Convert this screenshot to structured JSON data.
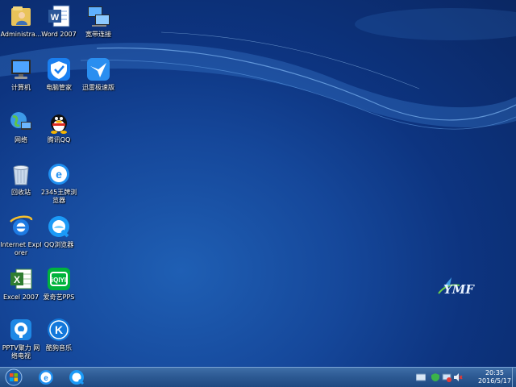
{
  "desktop": {
    "icons": [
      {
        "label": "Administra...",
        "icon": "user-folder-icon"
      },
      {
        "label": "Word 2007",
        "icon": "word-icon"
      },
      {
        "label": "宽带连接",
        "icon": "broadband-icon"
      },
      {
        "label": "计算机",
        "icon": "computer-icon"
      },
      {
        "label": "电脑管家",
        "icon": "pc-manager-icon"
      },
      {
        "label": "迅雷极速版",
        "icon": "thunder-icon"
      },
      {
        "label": "网络",
        "icon": "network-icon"
      },
      {
        "label": "腾讯QQ",
        "icon": "qq-icon"
      },
      {
        "label": "回收站",
        "icon": "recycle-bin-icon"
      },
      {
        "label": "2345王牌浏览器",
        "icon": "browser-2345-icon"
      },
      {
        "label": "Internet Explorer",
        "icon": "ie-icon"
      },
      {
        "label": "QQ浏览器",
        "icon": "qq-browser-icon"
      },
      {
        "label": "Excel 2007",
        "icon": "excel-icon"
      },
      {
        "label": "爱奇艺PPS",
        "icon": "iqiyi-icon"
      },
      {
        "label": "PPTV聚力 网络电视",
        "icon": "pptv-icon"
      },
      {
        "label": "酷狗音乐",
        "icon": "kugou-icon"
      }
    ]
  },
  "taskbar": {
    "clock": {
      "time": "20:35",
      "date": "2016/5/17"
    }
  },
  "colors": {
    "taskbar": "#2d5a93",
    "desktop": "#15479a"
  }
}
